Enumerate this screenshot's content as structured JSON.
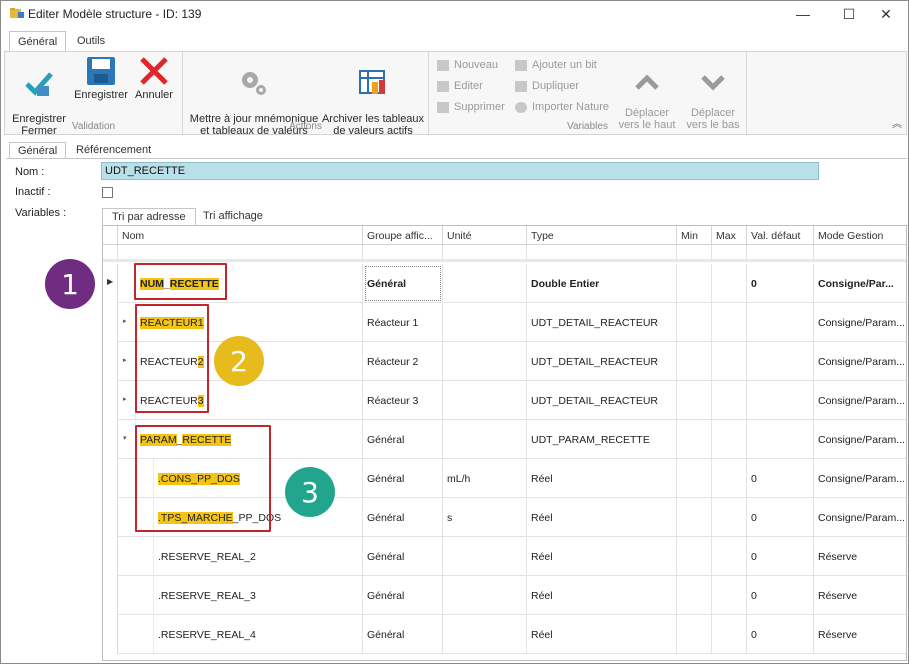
{
  "window": {
    "title": "Editer Modèle structure - ID: 139",
    "minimize": "—",
    "maximize": "☐",
    "close": "✕"
  },
  "ribbon": {
    "tabs": [
      "Général",
      "Outils"
    ],
    "groups": {
      "validation": {
        "label": "Validation",
        "buttons": [
          "Enregistrer\nFermer",
          "Enregistrer",
          "Annuler"
        ]
      },
      "actions": {
        "label": "Actions",
        "buttons": [
          "Mettre à jour mnémonique\net tableaux de valeurs",
          "Archiver les tableaux\nde valeurs actifs"
        ]
      },
      "variables": {
        "label": "Variables",
        "small_col1": [
          "Nouveau",
          "Editer",
          "Supprimer"
        ],
        "small_col2": [
          "Ajouter un bit",
          "Dupliquer",
          "Importer Nature"
        ],
        "move_up": "Déplacer\nvers le haut",
        "move_down": "Déplacer\nvers le bas"
      }
    },
    "collapse": "︽"
  },
  "form": {
    "tabs": [
      "Général",
      "Référencement"
    ],
    "labels": {
      "name": "Nom :",
      "inactive": "Inactif :",
      "variables": "Variables :"
    },
    "name_value": "UDT_RECETTE",
    "grid_tabs": [
      "Tri par adresse",
      "Tri affichage"
    ]
  },
  "grid": {
    "columns": [
      "Nom",
      "Groupe affic...",
      "Unité",
      "Type",
      "Min",
      "Max",
      "Val. défaut",
      "Mode Gestion"
    ],
    "rows": [
      {
        "name_hl": "NUM",
        "name_sep": "_",
        "name_hl2": "RECETTE",
        "name_rest": "",
        "group": "Général",
        "unit": "",
        "type": "Double Entier",
        "min": "",
        "max": "",
        "default": "0",
        "mode": "Consigne/Par...",
        "bold": true
      },
      {
        "name_hl": "REACTEUR1",
        "name_sep": "",
        "name_hl2": "",
        "name_rest": "",
        "group": "Réacteur 1",
        "unit": "",
        "type": "UDT_DETAIL_REACTEUR",
        "min": "",
        "max": "",
        "default": "",
        "mode": "Consigne/Param..."
      },
      {
        "name_hl": "",
        "name_sep": "REACTEUR",
        "name_hl2": "2",
        "name_rest": "",
        "group": "Réacteur 2",
        "unit": "",
        "type": "UDT_DETAIL_REACTEUR",
        "min": "",
        "max": "",
        "default": "",
        "mode": "Consigne/Param..."
      },
      {
        "name_hl": "",
        "name_sep": "REACTEUR",
        "name_hl2": "3",
        "name_rest": "",
        "group": "Réacteur 3",
        "unit": "",
        "type": "UDT_DETAIL_REACTEUR",
        "min": "",
        "max": "",
        "default": "",
        "mode": "Consigne/Param..."
      },
      {
        "name_hl": "PARAM",
        "name_sep": "_",
        "name_hl2": "RECETTE",
        "name_rest": "",
        "group": "Général",
        "unit": "",
        "type": "UDT_PARAM_RECETTE",
        "min": "",
        "max": "",
        "default": "",
        "mode": "Consigne/Param..."
      },
      {
        "name_hl": ".CONS_PP_DOS",
        "name_sep": "",
        "name_hl2": "",
        "name_rest": "",
        "group": "Général",
        "unit": "mL/h",
        "type": "Réel",
        "min": "",
        "max": "",
        "default": "0",
        "mode": "Consigne/Param..."
      },
      {
        "name_hl": ".TPS_MARCHE",
        "name_sep": "",
        "name_hl2": "",
        "name_rest": "_PP_DOS",
        "group": "Général",
        "unit": "s",
        "type": "Réel",
        "min": "",
        "max": "",
        "default": "0",
        "mode": "Consigne/Param..."
      },
      {
        "name_hl": "",
        "name_sep": "",
        "name_hl2": "",
        "name_rest": ".RESERVE_REAL_2",
        "group": "Général",
        "unit": "",
        "type": "Réel",
        "min": "",
        "max": "",
        "default": "0",
        "mode": "Réserve"
      },
      {
        "name_hl": "",
        "name_sep": "",
        "name_hl2": "",
        "name_rest": ".RESERVE_REAL_3",
        "group": "Général",
        "unit": "",
        "type": "Réel",
        "min": "",
        "max": "",
        "default": "0",
        "mode": "Réserve"
      },
      {
        "name_hl": "",
        "name_sep": "",
        "name_hl2": "",
        "name_rest": ".RESERVE_REAL_4",
        "group": "Général",
        "unit": "",
        "type": "Réel",
        "min": "",
        "max": "",
        "default": "0",
        "mode": "Réserve"
      }
    ]
  },
  "callouts": [
    "1",
    "2",
    "3"
  ],
  "colors": {
    "highlight": "#f3c316",
    "annotation_box": "#c0272d",
    "callout1": "#6f2c80",
    "callout2": "#e7bb1c",
    "callout3": "#21a68d",
    "name_field": "#b9dfe9"
  }
}
